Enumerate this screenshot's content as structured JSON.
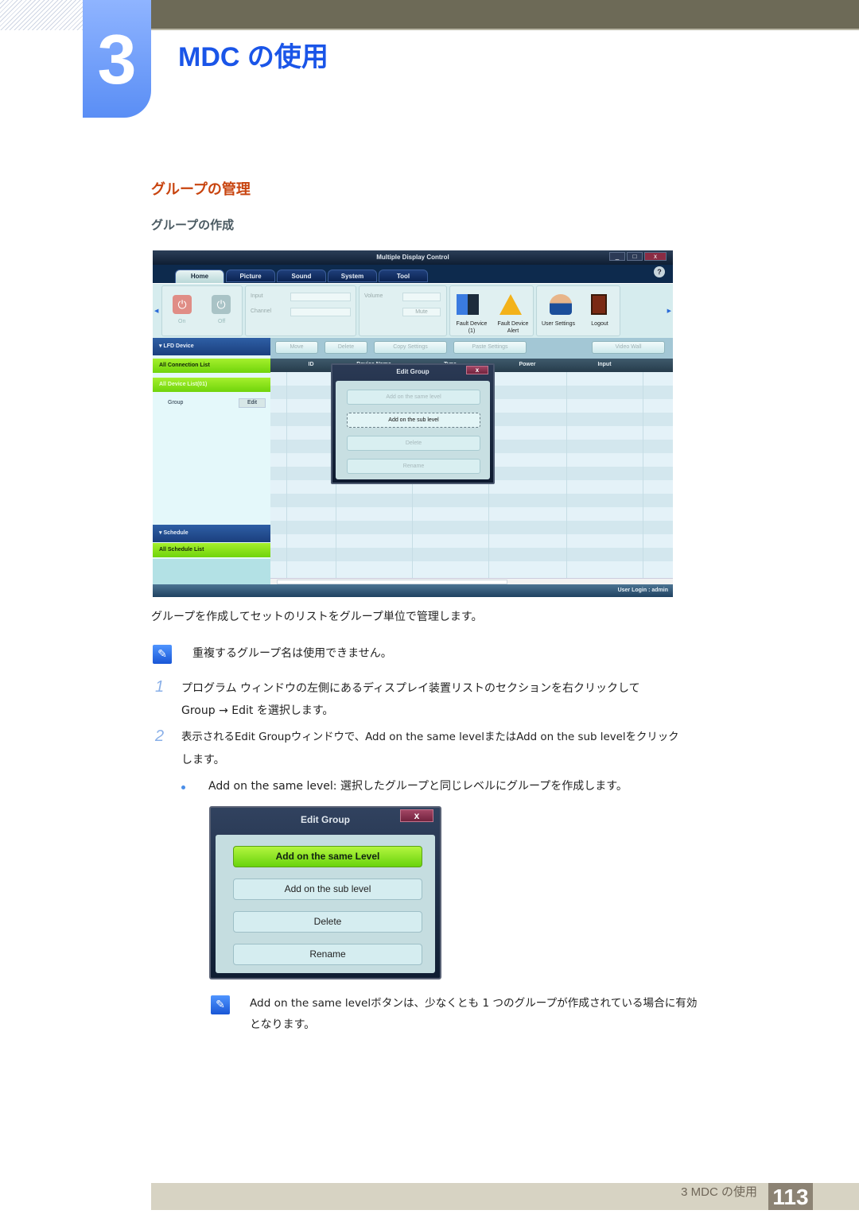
{
  "chapter": {
    "number": "3",
    "title": "MDC の使用"
  },
  "section": {
    "title": "グループの管理",
    "subtitle": "グループの作成"
  },
  "app": {
    "window_title": "Multiple Display Control",
    "window_buttons": [
      "_",
      "□",
      "x"
    ],
    "help": "?",
    "tabs": [
      {
        "label": "Home",
        "active": true
      },
      {
        "label": "Picture"
      },
      {
        "label": "Sound"
      },
      {
        "label": "System"
      },
      {
        "label": "Tool"
      }
    ],
    "ribbon": {
      "power_on": "On",
      "power_off": "Off",
      "input_label": "Input",
      "channel_label": "Channel",
      "volume_label": "Volume",
      "mute_label": "Mute",
      "fault_device": "Fault Device",
      "fault_device_count": "(1)",
      "fault_device_alert_1": "Fault Device",
      "fault_device_alert_2": "Alert",
      "user_settings": "User Settings",
      "logout": "Logout"
    },
    "sidebar": {
      "lfd_header": "LFD Device",
      "all_connection_list": "All Connection List",
      "all_device_list": "All Device List(01)",
      "group_label": "Group",
      "group_edit": "Edit",
      "schedule_header": "Schedule",
      "all_schedule_list": "All Schedule List"
    },
    "toolbar": {
      "move": "Move",
      "delete": "Delete",
      "copy_settings": "Copy Settings",
      "paste_settings": "Paste Settings",
      "video_wall": "Video Wall"
    },
    "grid_headers": [
      "ID",
      "Device Name",
      "Type",
      "Power",
      "Input"
    ],
    "status": "User Login : admin",
    "edit_group_dialog": {
      "title": "Edit Group",
      "close": "x",
      "buttons": [
        "Add on the same level",
        "Add on the sub level",
        "Delete",
        "Rename"
      ],
      "focused": "Add on the sub level"
    }
  },
  "body": {
    "intro": "グループを作成してセットのリストをグループ単位で管理します。",
    "note1": "重複するグループ名は使用できません。",
    "step1_num": "1",
    "step1_line1": "プログラム ウィンドウの左側にあるディスプレイ装置リストのセクションを右クリックして",
    "step1_line2": "Group → Edit を選択します。",
    "step2_num": "2",
    "step2_line1": "表示されるEdit Groupウィンドウで、Add on the same levelまたはAdd on the sub levelをクリック",
    "step2_line2": "します。",
    "bullet1": "Add on the same level: 選択したグループと同じレベルにグループを作成します。",
    "note2_line1": "Add on the same levelボタンは、少なくとも 1 つのグループが作成されている場合に有効",
    "note2_line2": "となります。"
  },
  "big_dialog": {
    "title": "Edit Group",
    "close": "x",
    "buttons": [
      "Add on the same Level",
      "Add on the sub level",
      "Delete",
      "Rename"
    ],
    "highlighted": "Add on the same Level"
  },
  "footer": {
    "text": "3 MDC の使用",
    "page": "113"
  }
}
